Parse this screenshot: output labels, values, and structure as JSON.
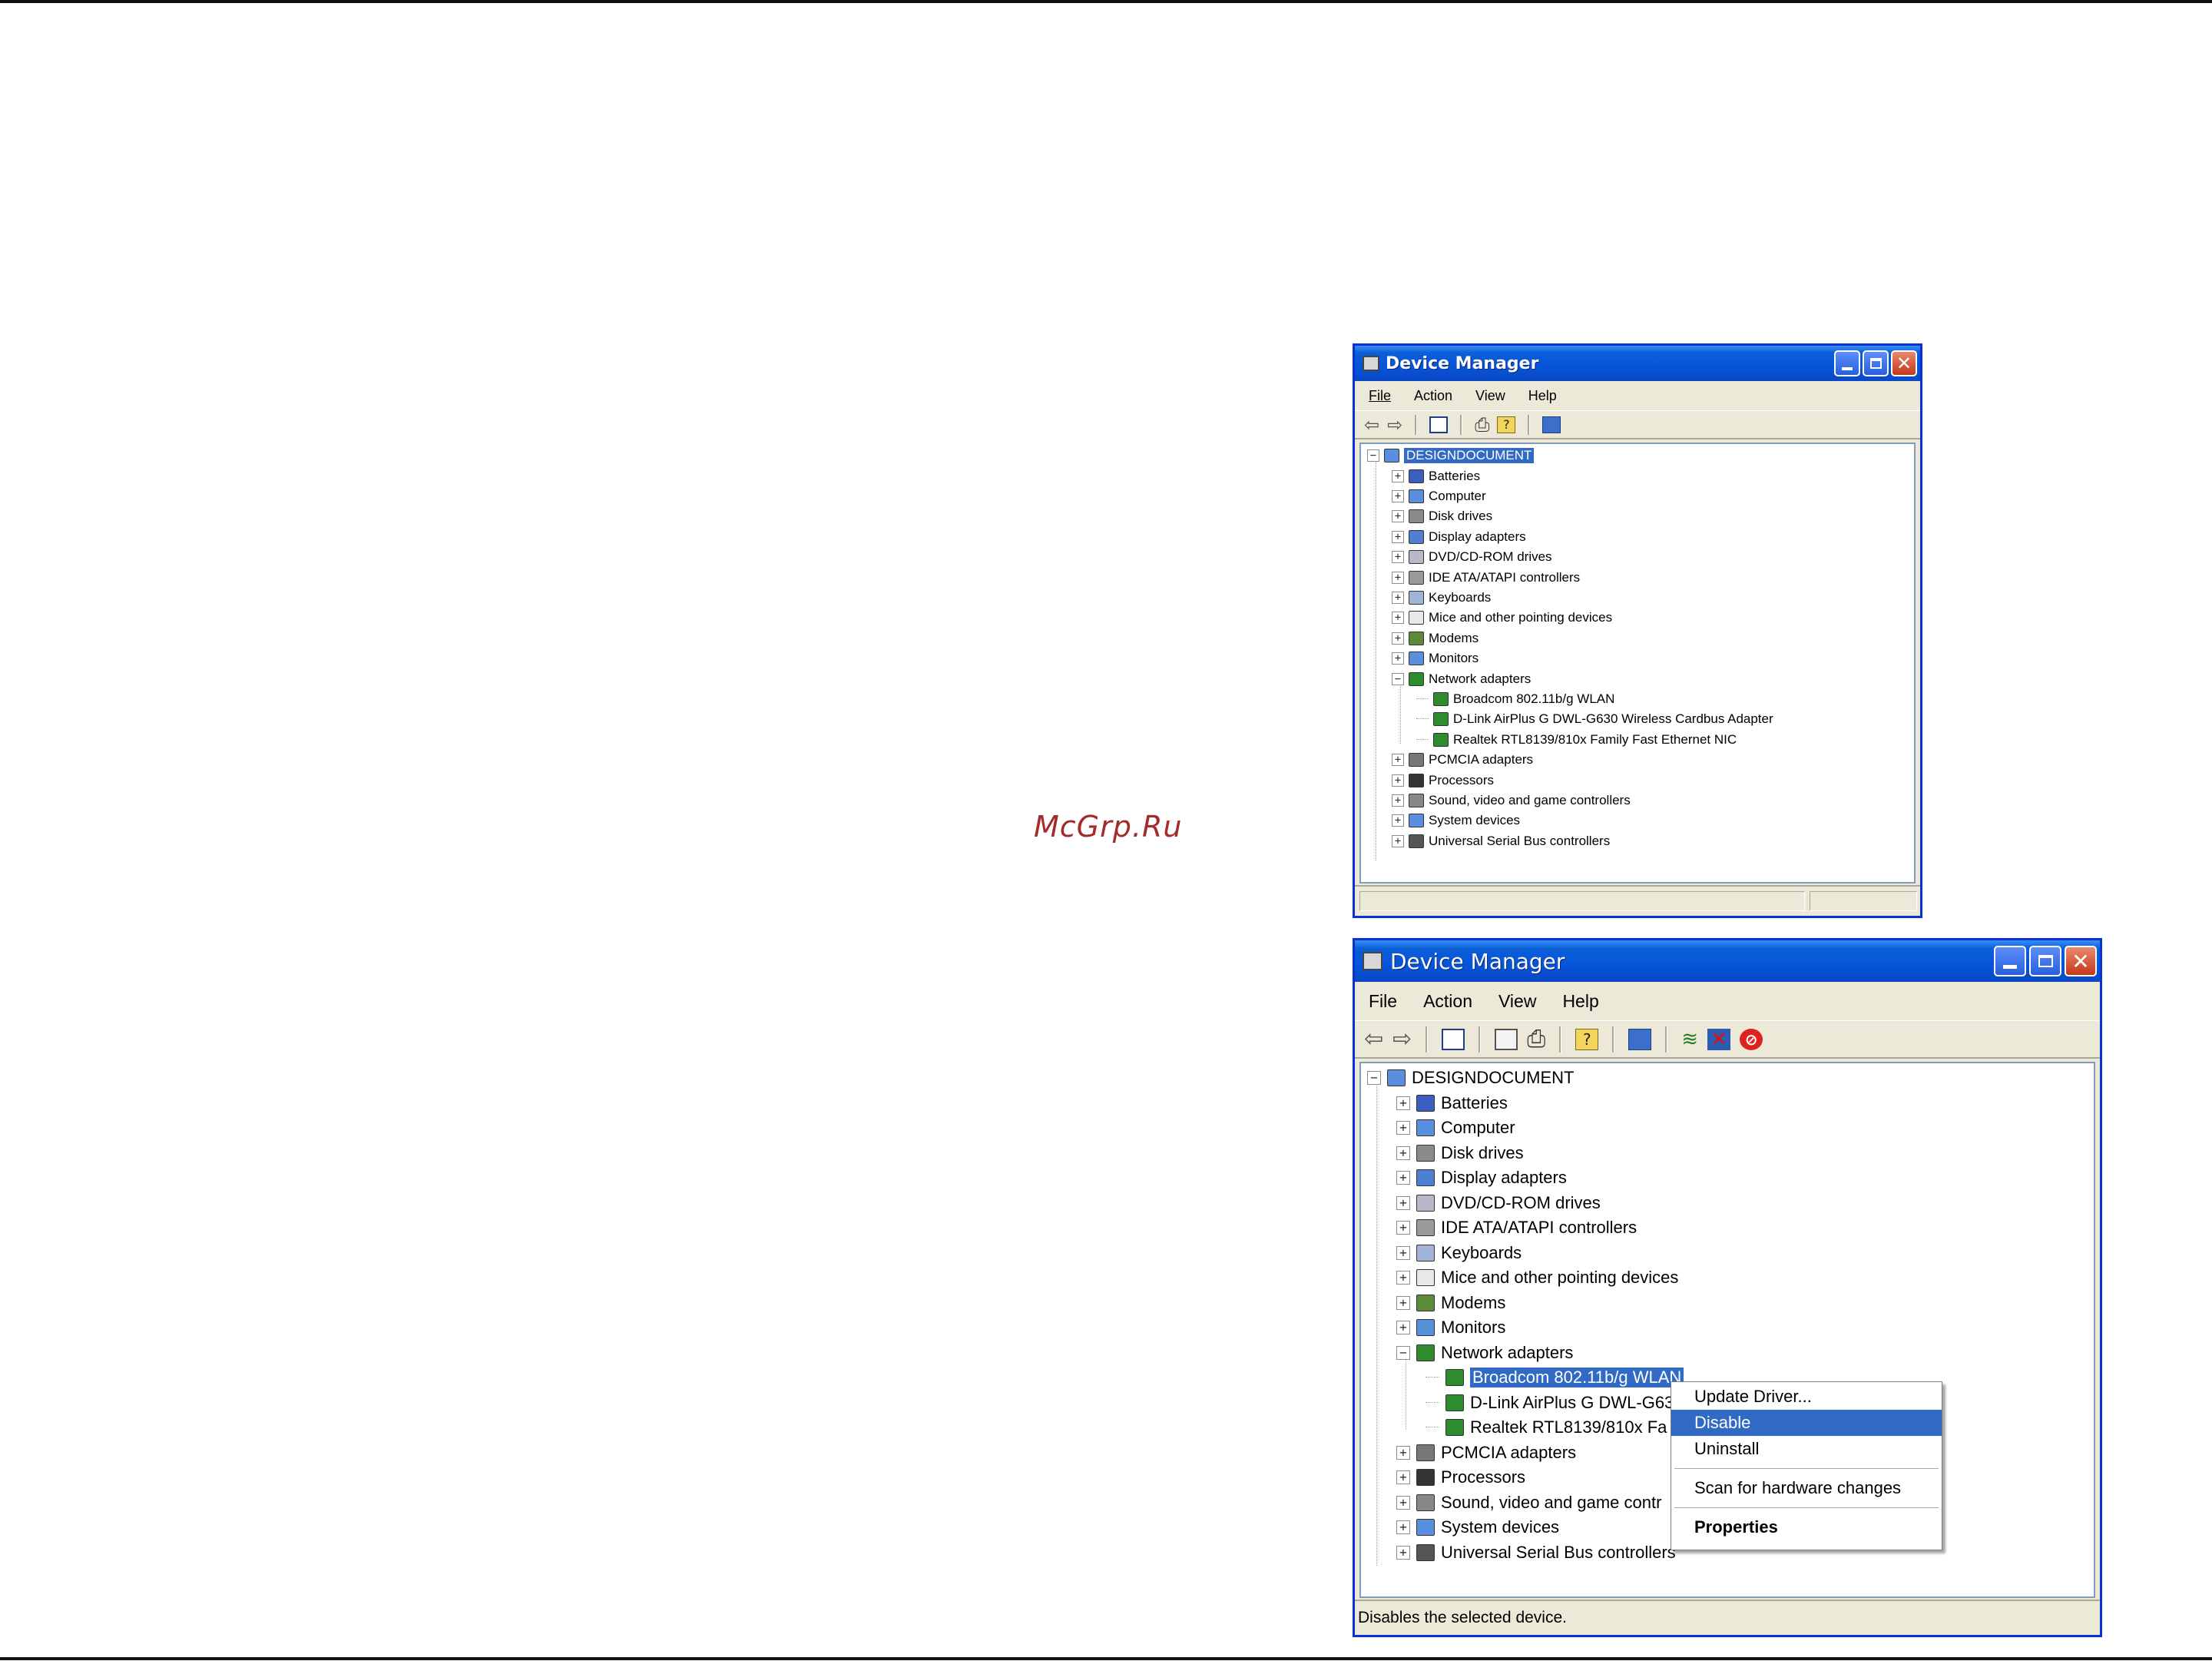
{
  "watermark": "McGrp.Ru",
  "window_small": {
    "title": "Device Manager",
    "menu": [
      "File",
      "Action",
      "View",
      "Help"
    ],
    "root": "DESIGNDOCUMENT",
    "categories": [
      {
        "label": "Batteries",
        "icon": "battery-icon"
      },
      {
        "label": "Computer",
        "icon": "computer-icon"
      },
      {
        "label": "Disk drives",
        "icon": "disk-drive-icon"
      },
      {
        "label": "Display adapters",
        "icon": "display-adapter-icon"
      },
      {
        "label": "DVD/CD-ROM drives",
        "icon": "dvd-drive-icon"
      },
      {
        "label": "IDE ATA/ATAPI controllers",
        "icon": "ide-controller-icon"
      },
      {
        "label": "Keyboards",
        "icon": "keyboard-icon"
      },
      {
        "label": "Mice and other pointing devices",
        "icon": "mouse-icon"
      },
      {
        "label": "Modems",
        "icon": "modem-icon"
      },
      {
        "label": "Monitors",
        "icon": "monitor-icon"
      },
      {
        "label": "Network adapters",
        "icon": "network-adapter-icon"
      },
      {
        "label": "Broadcom 802.11b/g WLAN",
        "icon": "network-card-icon"
      },
      {
        "label": "D-Link AirPlus G DWL-G630 Wireless Cardbus Adapter",
        "icon": "network-card-icon"
      },
      {
        "label": "Realtek RTL8139/810x Family Fast Ethernet NIC",
        "icon": "network-card-icon"
      },
      {
        "label": "PCMCIA adapters",
        "icon": "pcmcia-icon"
      },
      {
        "label": "Processors",
        "icon": "processor-icon"
      },
      {
        "label": "Sound, video and game controllers",
        "icon": "sound-icon"
      },
      {
        "label": "System devices",
        "icon": "system-device-icon"
      },
      {
        "label": "Universal Serial Bus controllers",
        "icon": "usb-icon"
      }
    ],
    "status": ""
  },
  "window_large": {
    "title": "Device Manager",
    "menu": [
      "File",
      "Action",
      "View",
      "Help"
    ],
    "root": "DESIGNDOCUMENT",
    "categories": [
      {
        "label": "Batteries"
      },
      {
        "label": "Computer"
      },
      {
        "label": "Disk drives"
      },
      {
        "label": "Display adapters"
      },
      {
        "label": "DVD/CD-ROM drives"
      },
      {
        "label": "IDE ATA/ATAPI controllers"
      },
      {
        "label": "Keyboards"
      },
      {
        "label": "Mice and other pointing devices"
      },
      {
        "label": "Modems"
      },
      {
        "label": "Monitors"
      },
      {
        "label": "Network adapters"
      },
      {
        "label": "Broadcom 802.11b/g WLAN"
      },
      {
        "label": "D-Link AirPlus G DWL-G63"
      },
      {
        "label": "Realtek RTL8139/810x Fa"
      },
      {
        "label": "PCMCIA adapters"
      },
      {
        "label": "Processors"
      },
      {
        "label": "Sound, video and game contr"
      },
      {
        "label": "System devices"
      },
      {
        "label": "Universal Serial Bus controllers"
      }
    ],
    "context_menu": {
      "items": [
        "Update Driver...",
        "Disable",
        "Uninstall",
        "Scan for hardware changes",
        "Properties"
      ],
      "highlighted": "Disable"
    },
    "status": "Disables the selected device."
  },
  "colors": {
    "titlebar": "#0654d9",
    "selection": "#316ac5",
    "window_face": "#ece9d8",
    "close_button": "#c5371c",
    "watermark": "#a52a2a"
  }
}
